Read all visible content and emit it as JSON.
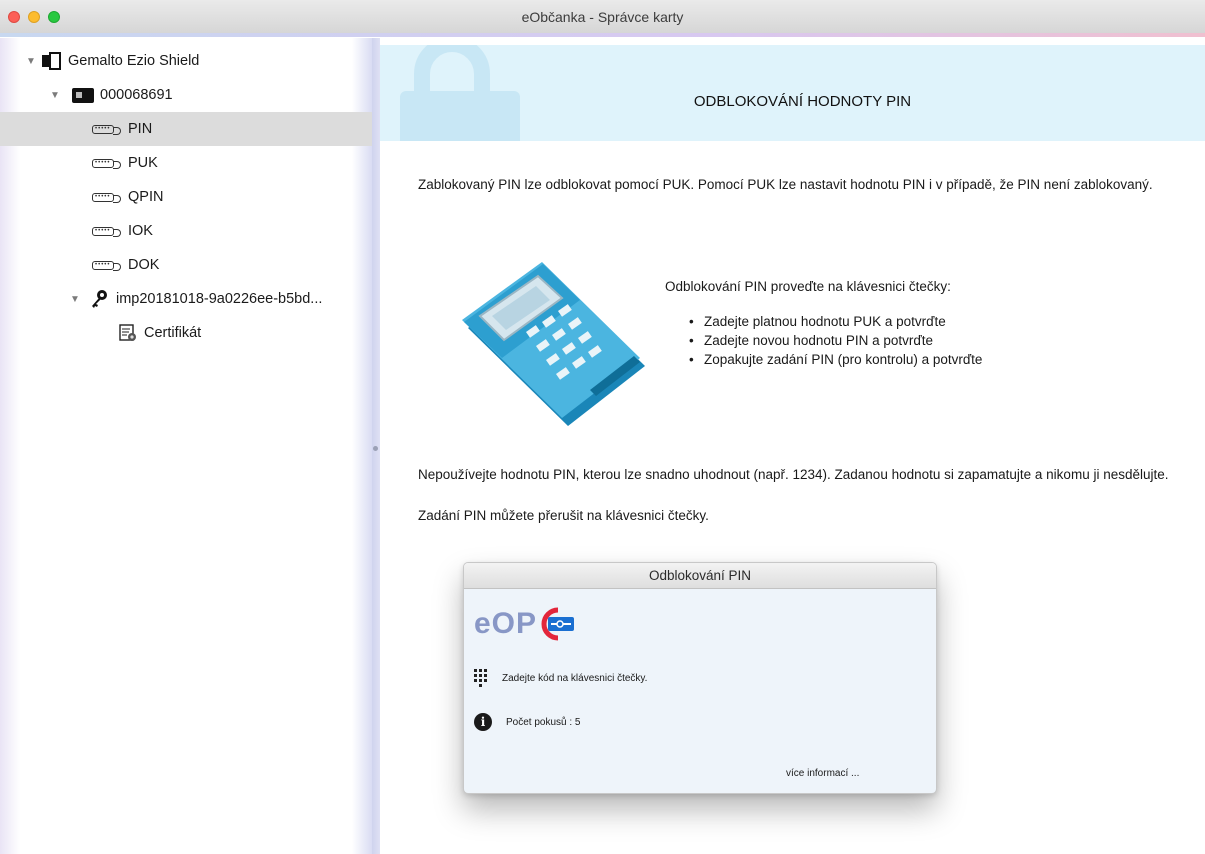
{
  "window": {
    "title": "eObčanka - Správce karty"
  },
  "sidebar": {
    "reader": "Gemalto Ezio Shield",
    "card": "000068691",
    "items": [
      {
        "label": "PIN",
        "selected": true
      },
      {
        "label": "PUK"
      },
      {
        "label": "QPIN"
      },
      {
        "label": "IOK"
      },
      {
        "label": "DOK"
      }
    ],
    "key": "imp20181018-9a0226ee-b5bd...",
    "certificate": "Certifikát"
  },
  "main": {
    "heading": "ODBLOKOVÁNÍ HODNOTY PIN",
    "intro": "Zablokovaný PIN lze odblokovat pomocí PUK. Pomocí PUK lze nastavit hodnotu PIN i v případě, že PIN není zablokovaný.",
    "instructions_title": "Odblokování PIN proveďte na klávesnici čtečky:",
    "steps": [
      "Zadejte platnou hodnotu PUK a potvrďte",
      "Zadejte novou hodnotu PIN a potvrďte",
      "Zopakujte zadání PIN (pro kontrolu) a potvrďte"
    ],
    "warning": "Nepoužívejte hodnotu PIN, kterou lze snadno uhodnout (např. 1234). Zadanou hodnotu si zapamatujte a nikomu ji nesdělujte.",
    "cancel_note": "Zadání PIN můžete přerušit na klávesnici čtečky."
  },
  "dialog": {
    "title": "Odblokování PIN",
    "logo_text": "eOP",
    "prompt": "Zadejte kód na klávesnici čtečky.",
    "attempts": "Počet pokusů : 5",
    "more_link": "více informací ..."
  },
  "colors": {
    "banner_bg": "#dff3fb",
    "selection": "#dcdcdc",
    "logo_blue": "#8897c6",
    "logo_red": "#e3263b",
    "logo_accent": "#1a6fd1"
  }
}
